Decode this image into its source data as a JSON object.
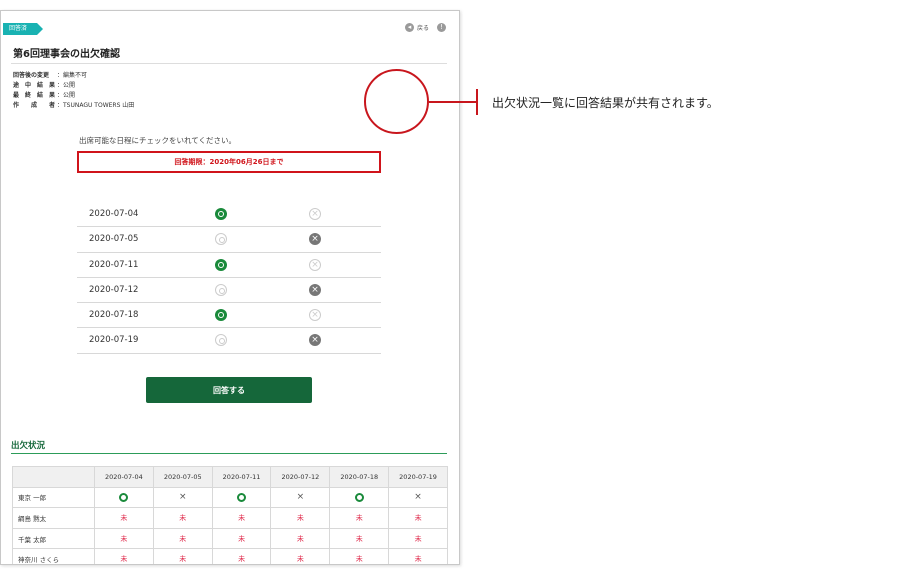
{
  "header": {
    "badge": "回答済",
    "back_label": "戻る",
    "back_icon": "◂",
    "help_icon": "!"
  },
  "title": "第6回理事会の出欠確認",
  "meta": [
    {
      "key": "回答後の変更",
      "value": "：編集不可"
    },
    {
      "key": "途　中　結　果",
      "value": "：公開"
    },
    {
      "key": "最　終　結　果",
      "value": "：公開"
    },
    {
      "key": "作　　成　　者",
      "value": "：TSUNAGU TOWERS 山田"
    }
  ],
  "instruction": "出席可能な日程にチェックをいれてください。",
  "deadline": "回答期限：2020年06月26日まで",
  "dates": [
    {
      "date": "2020-07-04",
      "answer": "yes"
    },
    {
      "date": "2020-07-05",
      "answer": "no"
    },
    {
      "date": "2020-07-11",
      "answer": "yes"
    },
    {
      "date": "2020-07-12",
      "answer": "no"
    },
    {
      "date": "2020-07-18",
      "answer": "yes"
    },
    {
      "date": "2020-07-19",
      "answer": "no"
    }
  ],
  "no_glyph": "×",
  "submit_label": "回答する",
  "status_section": {
    "title": "出欠状況",
    "columns": [
      "2020-07-04",
      "2020-07-05",
      "2020-07-11",
      "2020-07-12",
      "2020-07-18",
      "2020-07-19"
    ],
    "rows": [
      {
        "name": "東京 一郎",
        "cells": [
          "ok",
          "×",
          "ok",
          "×",
          "ok",
          "×"
        ]
      },
      {
        "name": "綱島 黙太",
        "cells": [
          "未",
          "未",
          "未",
          "未",
          "未",
          "未"
        ]
      },
      {
        "name": "千葉 太郎",
        "cells": [
          "未",
          "未",
          "未",
          "未",
          "未",
          "未"
        ]
      },
      {
        "name": "神奈川 さくら",
        "cells": [
          "未",
          "未",
          "未",
          "未",
          "未",
          "未"
        ]
      }
    ]
  },
  "callout": "出欠状況一覧に回答結果が共有されます。",
  "colors": {
    "accent_green": "#15673a",
    "badge_teal": "#19b2b2",
    "alert_red": "#d0141b",
    "pending_pink": "#e03050"
  }
}
